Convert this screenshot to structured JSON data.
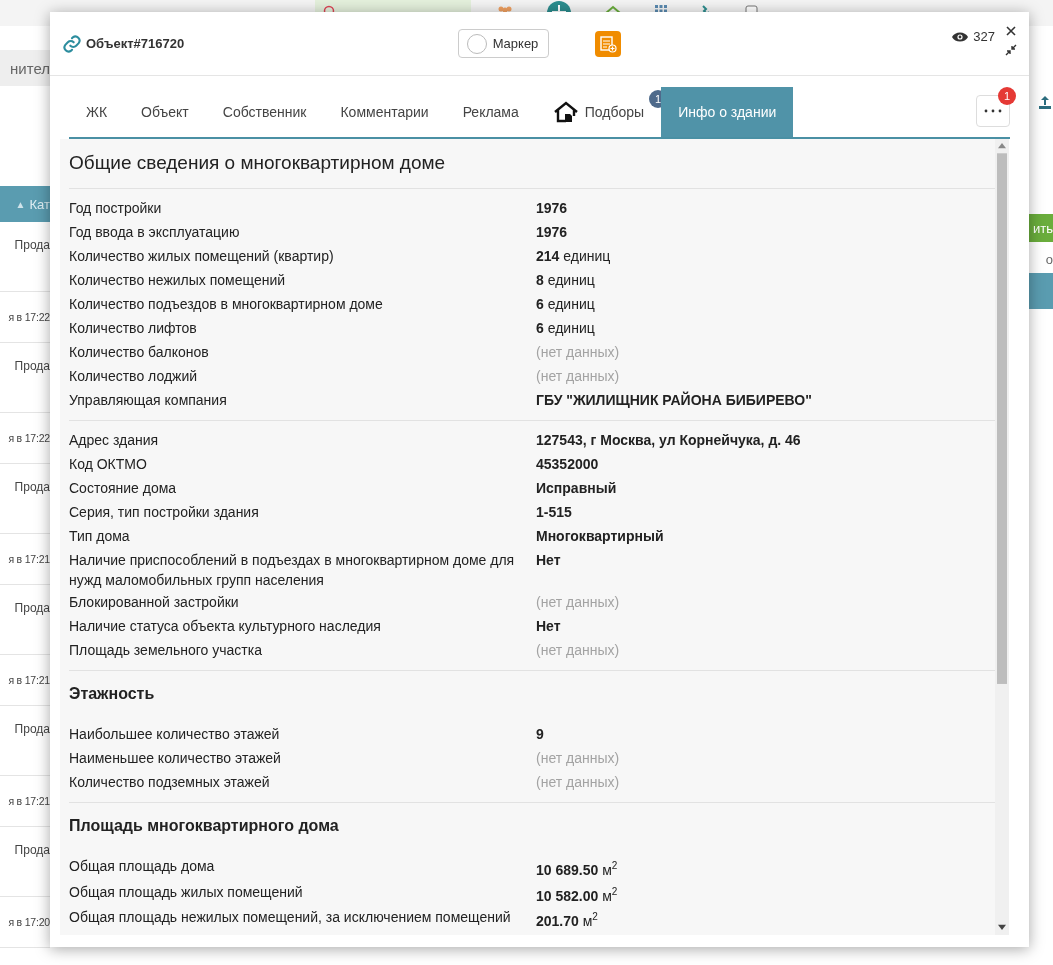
{
  "background": {
    "topbar": [
      {
        "kind": "search"
      },
      {
        "kind": "people"
      },
      {
        "kind": "plus"
      },
      {
        "kind": "home"
      },
      {
        "kind": "grid"
      },
      {
        "kind": "phone"
      },
      {
        "kind": "check"
      }
    ],
    "filter_field": "нител",
    "sort_arrow": "▲",
    "action_button": "ить",
    "side_text": "о",
    "column_header": "Кат",
    "rows": [
      {
        "category": "Прода",
        "time": "я в 17:22"
      },
      {
        "category": "Прода",
        "time": "я в 17:22"
      },
      {
        "category": "Прода",
        "time": "я в 17:21"
      },
      {
        "category": "Прода",
        "time": "я в 17:21"
      },
      {
        "category": "Прода",
        "time": "я в 17:21"
      },
      {
        "category": "Прода",
        "time": "я в 17:20"
      }
    ]
  },
  "modal": {
    "title": "Объект#716720",
    "marker": {
      "label": "Маркер",
      "checked": false
    },
    "views": "327",
    "tabs": [
      {
        "label": "ЖК",
        "selected": false
      },
      {
        "label": "Объект",
        "selected": false
      },
      {
        "label": "Собственник",
        "selected": false
      },
      {
        "label": "Комментарии",
        "selected": false
      },
      {
        "label": "Реклама",
        "selected": false
      },
      {
        "label": "Подборы",
        "selected": false,
        "icon": true,
        "badge": "1"
      },
      {
        "label": "Инфо о здании",
        "selected": true
      }
    ],
    "more_badge": "1",
    "sections": [
      {
        "title": "Общие сведения о многоквартирном доме",
        "groups": [
          [
            {
              "label": "Год постройки",
              "value": "1976",
              "kind": "bold"
            },
            {
              "label": "Год ввода в эксплуатацию",
              "value": "1976",
              "kind": "bold"
            },
            {
              "label": "Количество жилых помещений (квартир)",
              "value": "**214** единиц",
              "kind": "mixed"
            },
            {
              "label": "Количество нежилых помещений",
              "value": "**8** единиц",
              "kind": "mixed"
            },
            {
              "label": "Количество подъездов в многоквартирном доме",
              "value": "**6** единиц",
              "kind": "mixed"
            },
            {
              "label": "Количество лифтов",
              "value": "**6** единиц",
              "kind": "mixed"
            },
            {
              "label": "Количество балконов",
              "value": "(нет данных)",
              "kind": "missing"
            },
            {
              "label": "Количество лоджий",
              "value": "(нет данных)",
              "kind": "missing"
            },
            {
              "label": "Управляющая компания",
              "value": "ГБУ \"ЖИЛИЩНИК РАЙОНА БИБИРЕВО\"",
              "kind": "bold"
            }
          ],
          [
            {
              "label": "Адрес здания",
              "value": "127543, г Москва, ул Корнейчука, д. 46",
              "kind": "bold"
            },
            {
              "label": "Код ОКТМО",
              "value": "45352000",
              "kind": "bold"
            },
            {
              "label": "Состояние дома",
              "value": "Исправный",
              "kind": "bold"
            },
            {
              "label": "Серия, тип постройки здания",
              "value": "1-515",
              "kind": "bold"
            },
            {
              "label": "Тип дома",
              "value": "Многоквартирный",
              "kind": "bold"
            },
            {
              "label": "Наличие приспособлений в подъездах в многоквартирном доме для нужд маломобильных групп населения",
              "value": "Нет",
              "kind": "bold"
            },
            {
              "label": "Блокированной застройки",
              "value": "(нет данных)",
              "kind": "missing"
            },
            {
              "label": "Наличие статуса объекта культурного наследия",
              "value": "Нет",
              "kind": "bold"
            },
            {
              "label": "Площадь земельного участка",
              "value": "(нет данных)",
              "kind": "missing"
            }
          ]
        ]
      },
      {
        "title": "Этажность",
        "groups": [
          [
            {
              "label": "Наибольшее количество этажей",
              "value": "9",
              "kind": "bold"
            },
            {
              "label": "Наименьшее количество этажей",
              "value": "(нет данных)",
              "kind": "missing"
            },
            {
              "label": "Количество подземных этажей",
              "value": "(нет данных)",
              "kind": "missing"
            }
          ]
        ]
      },
      {
        "title": "Площадь многоквартирного дома",
        "groups": [
          [
            {
              "label": "Общая площадь дома",
              "value": "**10 689.50**  м$^{2}$",
              "kind": "mixed"
            },
            {
              "label": "Общая площадь жилых помещений",
              "value": "**10 582.00** м$^{2}$",
              "kind": "mixed"
            },
            {
              "label": "Общая площадь нежилых помещений, за исключением помещений",
              "value": "**201.70** м$^{2}$",
              "kind": "mixed"
            }
          ]
        ]
      }
    ]
  }
}
